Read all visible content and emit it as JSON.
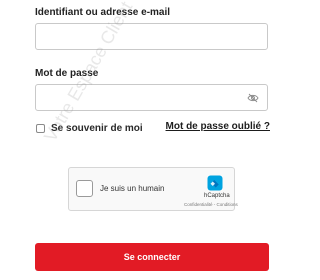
{
  "form": {
    "identifier_label": "Identifiant ou adresse e-mail",
    "identifier_value": "",
    "password_label": "Mot de passe",
    "password_value": "",
    "remember_label": "Se souvenir de moi",
    "forgot_label": "Mot de passe oublié ?",
    "submit_label": "Se connecter"
  },
  "captcha": {
    "prompt": "Je suis un humain",
    "brand": "hCaptcha",
    "links": "Confidentialité - Conditions"
  },
  "watermark": "Votre Espace Client",
  "colors": {
    "accent": "#e21b25",
    "captcha_logo_primary": "#0074bf",
    "captcha_logo_secondary": "#00a3e0"
  },
  "icons": {
    "password_toggle": "eye-off-icon",
    "captcha_logo": "hcaptcha-logo-icon"
  }
}
